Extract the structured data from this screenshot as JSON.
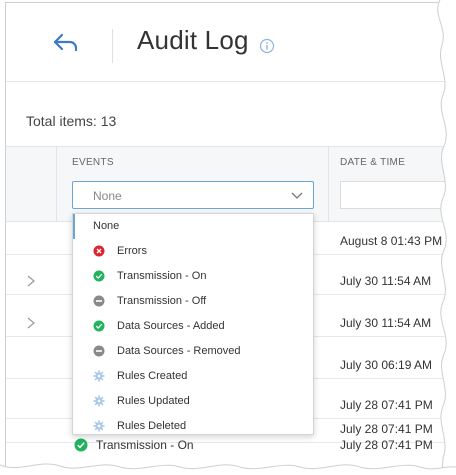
{
  "header": {
    "title": "Audit Log"
  },
  "toolbar": {
    "total_label": "Total items: 13"
  },
  "grid": {
    "columns": [
      "EVENTS",
      "DATE & TIME"
    ],
    "events_filter_value": "None",
    "rows": [
      {
        "datetime": "August 8 01:43 PM"
      },
      {
        "datetime": "July 30 11:54 AM"
      },
      {
        "datetime": "July 30 11:54 AM"
      },
      {
        "datetime": "July 30 06:19 AM"
      },
      {
        "datetime": "July 28 07:41 PM"
      },
      {
        "datetime": "July 28 07:41 PM"
      },
      {
        "event": "Transmission - On",
        "datetime": "July 28 07:41 PM"
      }
    ]
  },
  "dropdown": {
    "options": [
      {
        "label": "None",
        "icon": "none"
      },
      {
        "label": "Errors",
        "icon": "error-icon"
      },
      {
        "label": "Transmission - On",
        "icon": "check-icon"
      },
      {
        "label": "Transmission - Off",
        "icon": "minus-icon"
      },
      {
        "label": "Data Sources - Added",
        "icon": "check-icon"
      },
      {
        "label": "Data Sources - Removed",
        "icon": "minus-icon"
      },
      {
        "label": "Rules Created",
        "icon": "gear-icon"
      },
      {
        "label": "Rules Updated",
        "icon": "gear-icon"
      },
      {
        "label": "Rules Deleted",
        "icon": "gear-icon"
      }
    ]
  },
  "colors": {
    "error": "#d9262e",
    "success": "#22b35e",
    "neutral": "#8a8a8a",
    "gear": "#a9c8e8",
    "accent": "#3d79c4"
  }
}
